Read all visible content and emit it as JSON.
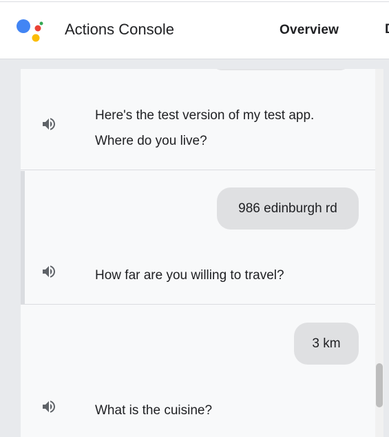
{
  "header": {
    "title": "Actions Console",
    "nav_overview": "Overview",
    "nav_next_clipped": "D",
    "logo_colors": [
      "#4285f4",
      "#ea4335",
      "#fbbc05",
      "#34a853"
    ]
  },
  "conversation": [
    {
      "bot_lines": [
        "Here's the test version of my test app.",
        "Where do you live?"
      ]
    },
    {
      "user": "986 edinburgh rd",
      "bot_lines": [
        "How far are you willing to travel?"
      ]
    },
    {
      "user": "3 km",
      "bot_lines": [
        "What is the cuisine?"
      ]
    }
  ],
  "icons": {
    "speaker": "speaker-icon"
  }
}
